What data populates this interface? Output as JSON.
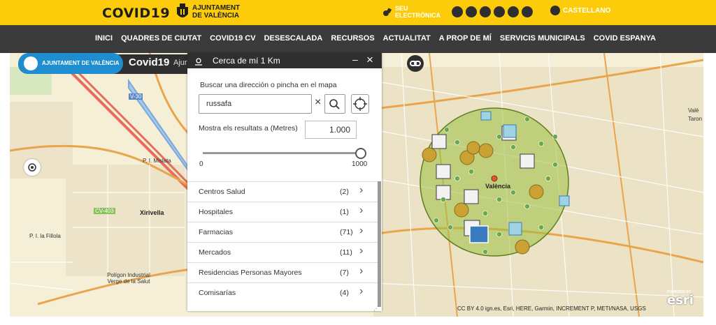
{
  "header": {
    "logo_text": "COVID19",
    "ajuntament": [
      "AJUNTAMENT",
      "DE VALÈNCIA"
    ],
    "seu": [
      "SEU",
      "ELECTRÒNICA"
    ],
    "social_icons": [
      "facebook-icon",
      "twitter-icon",
      "youtube-icon",
      "instagram-icon",
      "flickr-icon",
      "podcast-icon",
      "globe-icon"
    ],
    "language": "CASTELLANO"
  },
  "nav": [
    "INICI",
    "QUADRES DE CIUTAT",
    "COVID19 CV",
    "DESESCALADA",
    "RECURSOS",
    "ACTUALITAT",
    "A PROP DE MÍ",
    "SERVICIS MUNICIPALS",
    "COVID ESPANYA"
  ],
  "app": {
    "badge": "AJUNTAMENT DE VALÈNCIA",
    "title": "Covid19",
    "subtitle": "Ajun"
  },
  "widget": {
    "title": "Cerca de mí 1 Km",
    "search_label": "Buscar una dirección o pincha en el mapa",
    "search_value": "russafa",
    "radius_label": "Mostra els resultats a (Metres)",
    "radius_value": "1.000",
    "slider_min": "0",
    "slider_max": "1000",
    "slider_fraction": 1.0,
    "categories": [
      {
        "name": "Centros Salud",
        "count": "(2)"
      },
      {
        "name": "Hospitales",
        "count": "(1)"
      },
      {
        "name": "Farmacias",
        "count": "(71)"
      },
      {
        "name": "Mercados",
        "count": "(11)"
      },
      {
        "name": "Residencias Personas Mayores",
        "count": "(7)"
      },
      {
        "name": "Comisarías",
        "count": "(4)"
      }
    ]
  },
  "map": {
    "labels": [
      "V-30",
      "P. I. Mislata",
      "Xirivella",
      "CV-403",
      "P. I. la Fillola",
      "Polígon Industrial Verge de la Salut",
      "València",
      "Valè",
      "Taron"
    ],
    "attribution": "CC BY 4.0 ign.es, Esri, HERE, Garmin, INCREMENT P, METI/NASA, USGS",
    "esri": "esri",
    "powered_by": "POWERED BY",
    "buffer_color": "#9bbf3e"
  }
}
